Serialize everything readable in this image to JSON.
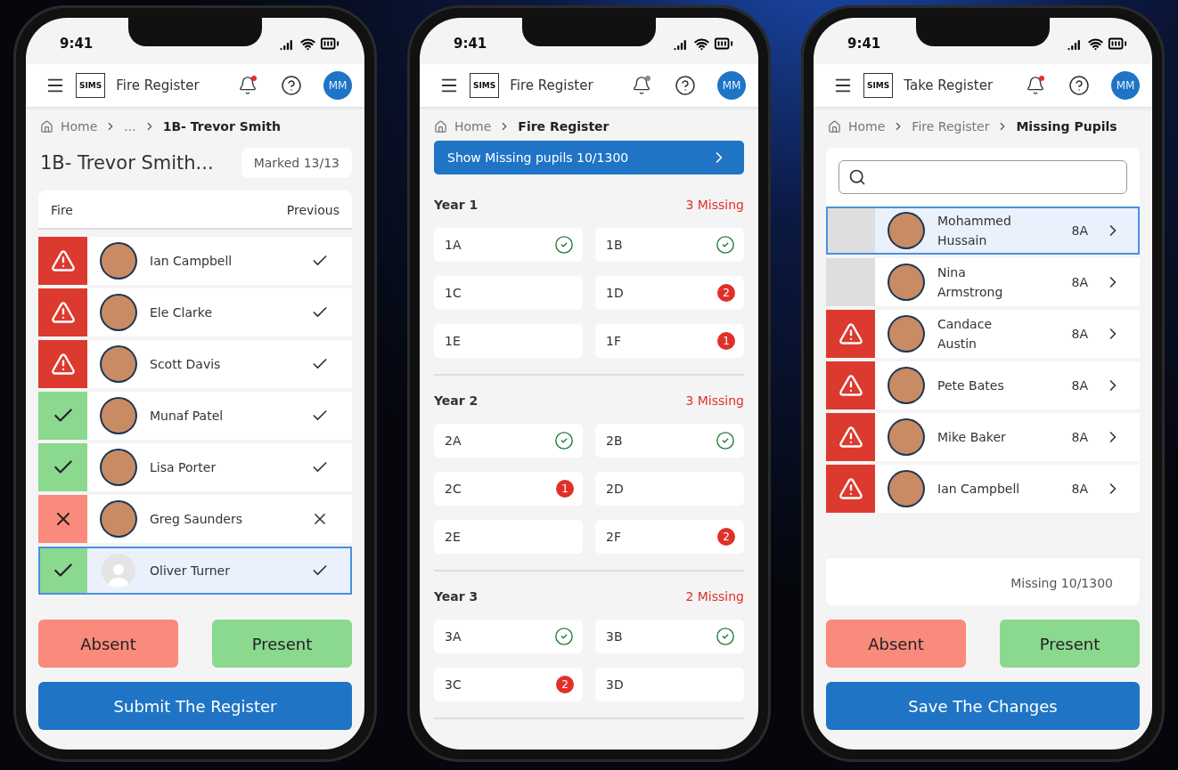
{
  "phones": [
    {
      "kind": "register",
      "time": "9:41",
      "logo": "SIMS",
      "app_title": "Fire Register",
      "alert": true,
      "avatar": "MM",
      "breadcrumb": [
        {
          "label": "Home",
          "current": false
        },
        {
          "label": "...",
          "current": false
        },
        {
          "label": "1B- Trevor Smith",
          "current": true
        }
      ],
      "heading": "1B- Trevor Smith...",
      "marked": "Marked  13/13",
      "columns": [
        "Fire",
        "Previous"
      ],
      "pupils": [
        {
          "name": "Ian Campbell",
          "kind": "missing",
          "photo": true,
          "previous_present": true,
          "selected": false
        },
        {
          "name": "Ele Clarke",
          "kind": "missing",
          "photo": true,
          "previous_present": true,
          "selected": false
        },
        {
          "name": "Scott Davis",
          "kind": "missing",
          "photo": true,
          "previous_present": true,
          "selected": false
        },
        {
          "name": "Munaf Patel",
          "kind": "present",
          "photo": true,
          "previous_present": true,
          "selected": false
        },
        {
          "name": "Lisa Porter",
          "kind": "present",
          "photo": true,
          "previous_present": true,
          "selected": false
        },
        {
          "name": "Greg Saunders",
          "kind": "absent",
          "photo": true,
          "previous_present": false,
          "selected": false
        },
        {
          "name": "Oliver Turner",
          "kind": "present",
          "photo": false,
          "previous_present": true,
          "selected": true
        }
      ],
      "buttons": [
        "Absent",
        "Present"
      ],
      "submit": "Submit The Register"
    },
    {
      "kind": "overview",
      "time": "9:41",
      "logo": "SIMS",
      "app_title": "Fire Register",
      "alert": false,
      "avatar": "MM",
      "breadcrumb": [
        {
          "label": "Home",
          "current": false
        },
        {
          "label": "Fire Register",
          "current": true
        }
      ],
      "banner": "Show Missing pupils  10/1300",
      "years": [
        {
          "title": "Year 1",
          "missing": "3 Missing",
          "classes": [
            {
              "name": "1A",
              "done": true
            },
            {
              "name": "1B",
              "done": true
            },
            {
              "name": "1C",
              "done": false
            },
            {
              "name": "1D",
              "done": false,
              "count": "2"
            },
            {
              "name": "1E",
              "done": false
            },
            {
              "name": "1F",
              "done": false,
              "count": "1"
            }
          ]
        },
        {
          "title": "Year 2",
          "missing": "3 Missing",
          "classes": [
            {
              "name": "2A",
              "done": true
            },
            {
              "name": "2B",
              "done": true
            },
            {
              "name": "2C",
              "done": false,
              "count": "1"
            },
            {
              "name": "2D",
              "done": false
            },
            {
              "name": "2E",
              "done": false
            },
            {
              "name": "2F",
              "done": false,
              "count": "2"
            }
          ]
        },
        {
          "title": "Year 3",
          "missing": "2 Missing",
          "classes": [
            {
              "name": "3A",
              "done": true
            },
            {
              "name": "3B",
              "done": true
            },
            {
              "name": "3C",
              "done": false,
              "count": "2"
            },
            {
              "name": "3D",
              "done": false
            }
          ]
        }
      ]
    },
    {
      "kind": "missing",
      "time": "9:41",
      "logo": "SIMS",
      "app_title": "Take Register",
      "alert": true,
      "avatar": "MM",
      "breadcrumb": [
        {
          "label": "Home",
          "current": false
        },
        {
          "label": "Fire Register",
          "current": false
        },
        {
          "label": "Missing Pupils",
          "current": true
        }
      ],
      "pupils": [
        {
          "name": "Mohammed Hussain",
          "form": "8A",
          "kind": "unmarked",
          "photo": true,
          "selected": true
        },
        {
          "name": "Nina Armstrong",
          "form": "8A",
          "kind": "unmarked",
          "photo": true,
          "selected": false
        },
        {
          "name": "Candace Austin",
          "form": "8A",
          "kind": "missing",
          "photo": true,
          "selected": false
        },
        {
          "name": "Pete Bates",
          "form": "8A",
          "kind": "missing",
          "photo": true,
          "selected": false
        },
        {
          "name": "Mike Baker",
          "form": "8A",
          "kind": "missing",
          "photo": true,
          "selected": false
        },
        {
          "name": "Ian Campbell",
          "form": "8A",
          "kind": "missing",
          "photo": true,
          "selected": false
        }
      ],
      "footer": "Missing  10/1300",
      "buttons": [
        "Absent",
        "Present"
      ],
      "submit": "Save The Changes"
    }
  ]
}
